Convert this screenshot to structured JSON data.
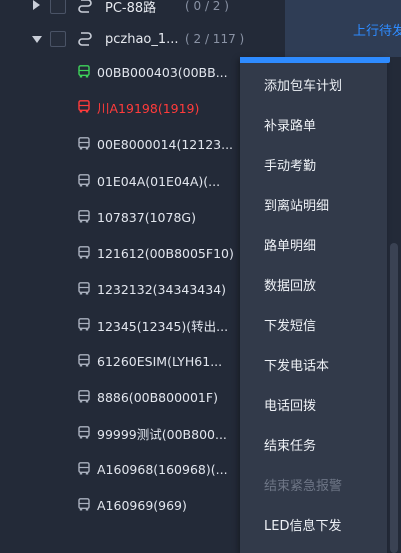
{
  "tree": {
    "groups": [
      {
        "label": "PC-88路",
        "count": "( 0 / 2 )",
        "expanded": false
      },
      {
        "label": "pczhao_1...",
        "count": "( 2 / 117 )",
        "expanded": true
      }
    ],
    "vehicles": [
      {
        "label": "00BB000403(00BB...",
        "status": "online"
      },
      {
        "label": "川A19198(1919)",
        "status": "alarm"
      },
      {
        "label": "00E8000014(12123...",
        "status": "offline"
      },
      {
        "label": "01E04A(01E04A)(...",
        "status": "offline"
      },
      {
        "label": "107837(1078G)",
        "status": "offline"
      },
      {
        "label": "121612(00B8005F10)",
        "status": "offline"
      },
      {
        "label": "1232132(34343434)",
        "status": "offline"
      },
      {
        "label": "12345(12345)(转出...",
        "status": "offline"
      },
      {
        "label": "61260ESIM(LYH61...",
        "status": "offline"
      },
      {
        "label": "8886(00B800001F)",
        "status": "offline"
      },
      {
        "label": "99999测试(00B800...",
        "status": "offline"
      },
      {
        "label": "A160968(160968)(...",
        "status": "offline"
      },
      {
        "label": "A160969(969)",
        "status": "offline"
      }
    ]
  },
  "header": {
    "tab_label": "上行待发"
  },
  "context_menu": {
    "items": [
      {
        "label": "添加包车计划",
        "enabled": true
      },
      {
        "label": "补录路单",
        "enabled": true
      },
      {
        "label": "手动考勤",
        "enabled": true
      },
      {
        "label": "到离站明细",
        "enabled": true
      },
      {
        "label": "路单明细",
        "enabled": true
      },
      {
        "label": "数据回放",
        "enabled": true
      },
      {
        "label": "下发短信",
        "enabled": true
      },
      {
        "label": "下发电话本",
        "enabled": true
      },
      {
        "label": "电话回拨",
        "enabled": true
      },
      {
        "label": "结束任务",
        "enabled": true
      },
      {
        "label": "结束紧急报警",
        "enabled": false
      },
      {
        "label": "LED信息下发",
        "enabled": true
      }
    ]
  },
  "colors": {
    "online": "#3ed35a",
    "alarm": "#ff3b3b",
    "offline": "#aab1bf",
    "accent": "#2e8bff"
  }
}
